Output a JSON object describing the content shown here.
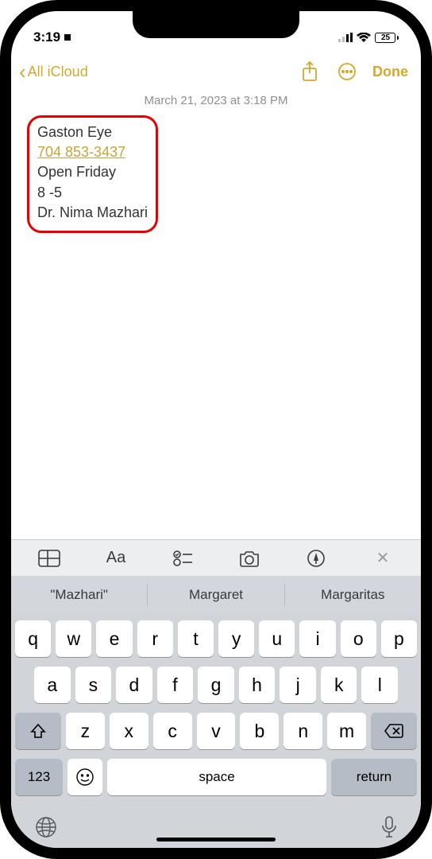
{
  "status": {
    "time": "3:19",
    "battery_pct": "25"
  },
  "nav": {
    "back_label": "All iCloud",
    "done": "Done"
  },
  "note": {
    "timestamp": "March 21, 2023 at 3:18 PM",
    "lines": {
      "l1": "Gaston Eye",
      "l2": "704 853-3437",
      "l3": "Open Friday",
      "l4": "8 -5",
      "l5": "Dr. Nima Mazhari"
    }
  },
  "suggestions": {
    "s1": "\"Mazhari\"",
    "s2": "Margaret",
    "s3": "Margaritas"
  },
  "keyboard": {
    "row1": {
      "k0": "q",
      "k1": "w",
      "k2": "e",
      "k3": "r",
      "k4": "t",
      "k5": "y",
      "k6": "u",
      "k7": "i",
      "k8": "o",
      "k9": "p"
    },
    "row2": {
      "k0": "a",
      "k1": "s",
      "k2": "d",
      "k3": "f",
      "k4": "g",
      "k5": "h",
      "k6": "j",
      "k7": "k",
      "k8": "l"
    },
    "row3": {
      "k0": "z",
      "k1": "x",
      "k2": "c",
      "k3": "v",
      "k4": "b",
      "k5": "n",
      "k6": "m"
    },
    "numkey": "123",
    "space": "space",
    "return": "return"
  }
}
